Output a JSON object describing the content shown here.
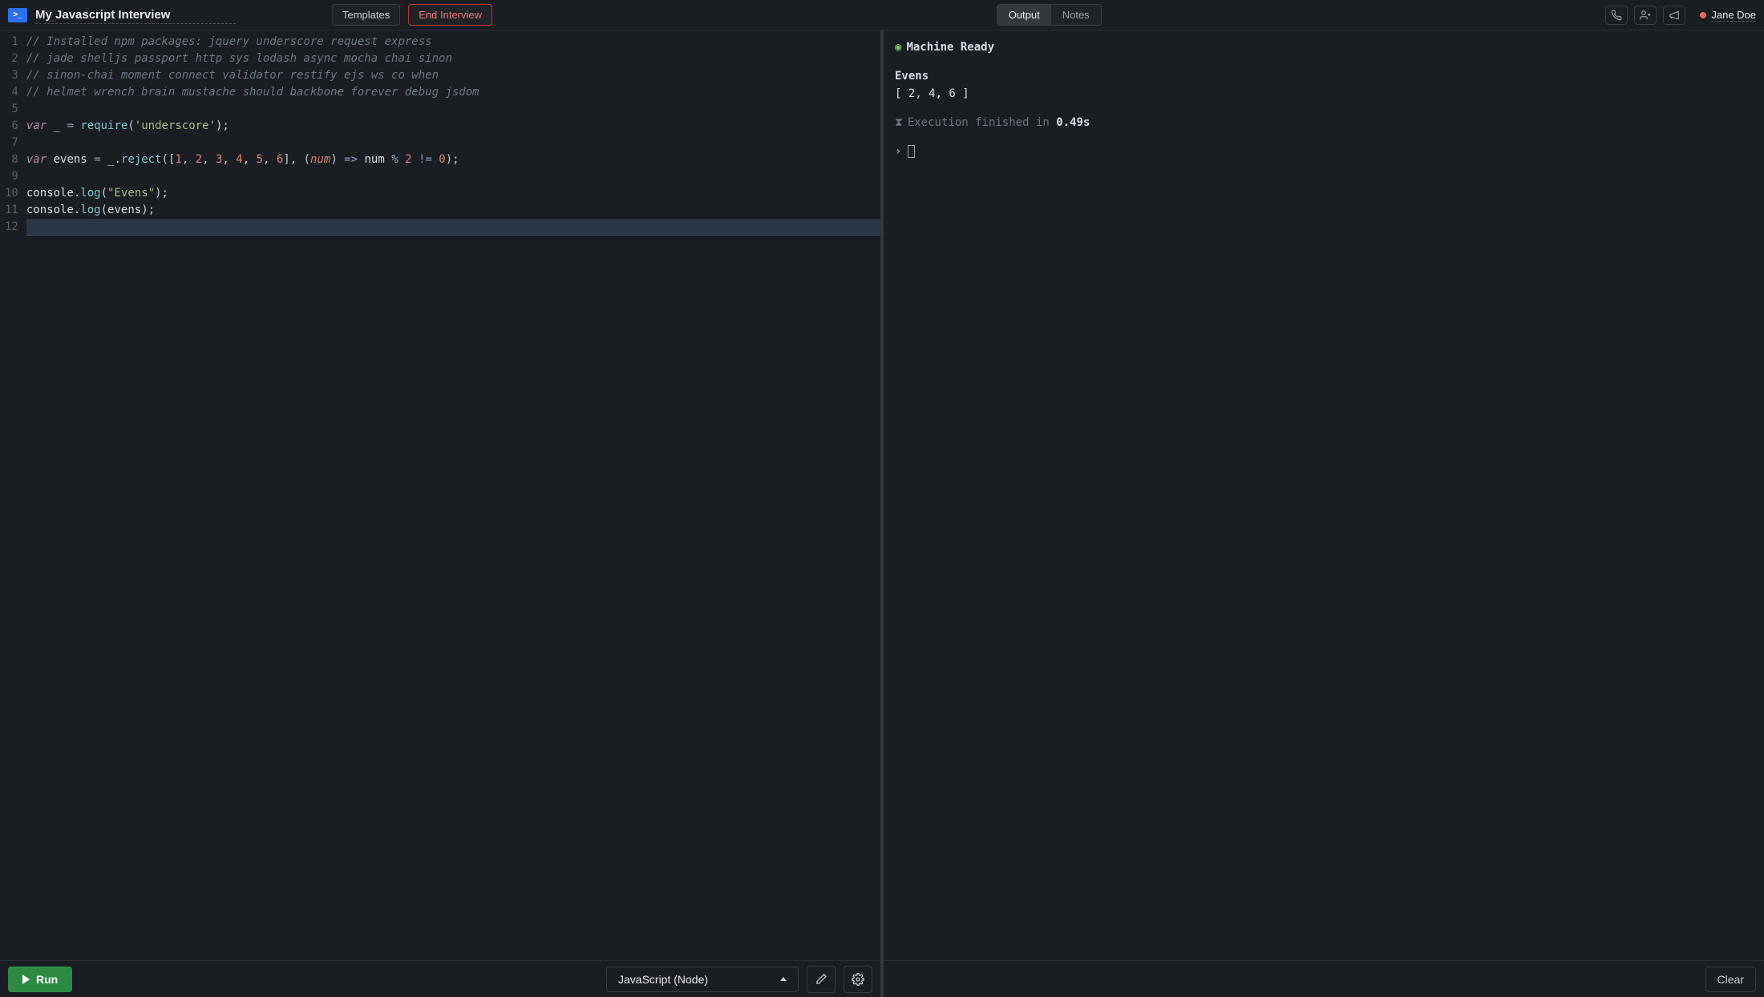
{
  "title": "My Javascript Interview",
  "topbar": {
    "templates_label": "Templates",
    "end_interview_label": "End Interview"
  },
  "right_tabs": {
    "output_label": "Output",
    "notes_label": "Notes",
    "active": "output"
  },
  "user": {
    "name": "Jane Doe",
    "status_color": "#e06c60"
  },
  "editor": {
    "language": "JavaScript (Node)",
    "lines": [
      {
        "n": 1,
        "type": "comment",
        "text": "// Installed npm packages: jquery underscore request express"
      },
      {
        "n": 2,
        "type": "comment",
        "text": "// jade shelljs passport http sys lodash async mocha chai sinon"
      },
      {
        "n": 3,
        "type": "comment",
        "text": "// sinon-chai moment connect validator restify ejs ws co when"
      },
      {
        "n": 4,
        "type": "comment",
        "text": "// helmet wrench brain mustache should backbone forever debug jsdom"
      },
      {
        "n": 5,
        "type": "blank",
        "text": ""
      },
      {
        "n": 6,
        "type": "code",
        "html": "<span class='tok-keyword'>var</span> <span class='tok-ident'>_</span> <span class='tok-op'>=</span> <span class='tok-func'>require</span><span class='tok-punct'>(</span><span class='tok-string'>'underscore'</span><span class='tok-punct'>);</span>"
      },
      {
        "n": 7,
        "type": "blank",
        "text": ""
      },
      {
        "n": 8,
        "type": "code",
        "html": "<span class='tok-keyword'>var</span> <span class='tok-ident'>evens</span> <span class='tok-op'>=</span> <span class='tok-ident'>_</span><span class='tok-punct'>.</span><span class='tok-func'>reject</span><span class='tok-punct'>([</span><span class='tok-number'>1</span><span class='tok-punct'>, </span><span class='tok-number'>2</span><span class='tok-punct'>, </span><span class='tok-number'>3</span><span class='tok-punct'>, </span><span class='tok-number'>4</span><span class='tok-punct'>, </span><span class='tok-number'>5</span><span class='tok-punct'>, </span><span class='tok-number'>6</span><span class='tok-punct'>], (</span><span class='tok-param'>num</span><span class='tok-punct'>) </span><span class='tok-op'>=&gt;</span><span class='tok-punct'> </span><span class='tok-ident'>num</span> <span class='tok-op'>%</span> <span class='tok-number'>2</span> <span class='tok-op'>!=</span> <span class='tok-number'>0</span><span class='tok-punct'>);</span>"
      },
      {
        "n": 9,
        "type": "blank",
        "text": ""
      },
      {
        "n": 10,
        "type": "code",
        "html": "<span class='tok-ident'>console</span><span class='tok-punct'>.</span><span class='tok-func'>log</span><span class='tok-punct'>(</span><span class='tok-string'>\"Evens\"</span><span class='tok-punct'>);</span>"
      },
      {
        "n": 11,
        "type": "code",
        "html": "<span class='tok-ident'>console</span><span class='tok-punct'>.</span><span class='tok-func'>log</span><span class='tok-punct'>(</span><span class='tok-ident'>evens</span><span class='tok-punct'>);</span>"
      },
      {
        "n": 12,
        "type": "current",
        "text": ""
      }
    ]
  },
  "output": {
    "machine_status": "Machine Ready",
    "stdout_line1": "Evens",
    "stdout_line2": "[ 2, 4, 6 ]",
    "exec_prefix": "Execution finished in ",
    "exec_time": "0.49s",
    "prompt": "›"
  },
  "bottombar": {
    "run_label": "Run",
    "clear_label": "Clear"
  }
}
